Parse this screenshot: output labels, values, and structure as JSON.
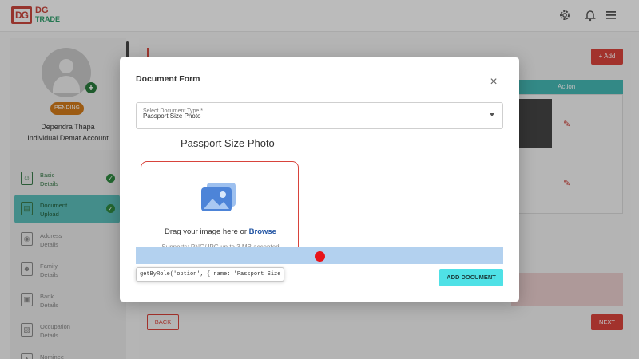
{
  "app": {
    "logo_mark": "DG",
    "logo_line1": "DG",
    "logo_line2": "TRADE",
    "icons": [
      "gear-icon",
      "bell-icon",
      "menu-icon"
    ]
  },
  "profile": {
    "status": "PENDING",
    "name": "Dependra Thapa",
    "account_type": "Individual Demat Account"
  },
  "steps": [
    {
      "line1": "Basic",
      "line2": "Details",
      "done": true,
      "active": false,
      "icon": "person-form-icon"
    },
    {
      "line1": "Document",
      "line2": "Upload",
      "done": true,
      "active": true,
      "icon": "document-icon"
    },
    {
      "line1": "Address",
      "line2": "Details",
      "done": false,
      "active": false,
      "icon": "location-icon"
    },
    {
      "line1": "Family",
      "line2": "Details",
      "done": false,
      "active": false,
      "icon": "family-icon"
    },
    {
      "line1": "Bank",
      "line2": "Details",
      "done": false,
      "active": false,
      "icon": "bank-icon"
    },
    {
      "line1": "Occupation",
      "line2": "Details",
      "done": false,
      "active": false,
      "icon": "briefcase-icon"
    },
    {
      "line1": "Nominee",
      "line2": "",
      "done": false,
      "active": false,
      "icon": "nominee-icon"
    }
  ],
  "main": {
    "add_label": "+ Add",
    "table_header_action": "Action",
    "back_label": "BACK",
    "next_label": "NEXT"
  },
  "modal": {
    "title": "Document Form",
    "select_label": "Select Document Type *",
    "select_value": "Passport Size Photo",
    "section_heading": "Passport Size Photo",
    "drop_text": "Drag your image here or",
    "browse_label": "Browse",
    "drop_hint": "Supports: PNG/JPG up to 3 MB accepted",
    "add_document_label": "ADD DOCUMENT"
  },
  "tooltip": {
    "text": "getByRole('option', { name: 'Passport Size Photo' })"
  },
  "colors": {
    "brand_red": "#d8433b",
    "teal": "#44b7b3",
    "add_document": "#4fe1e6"
  }
}
